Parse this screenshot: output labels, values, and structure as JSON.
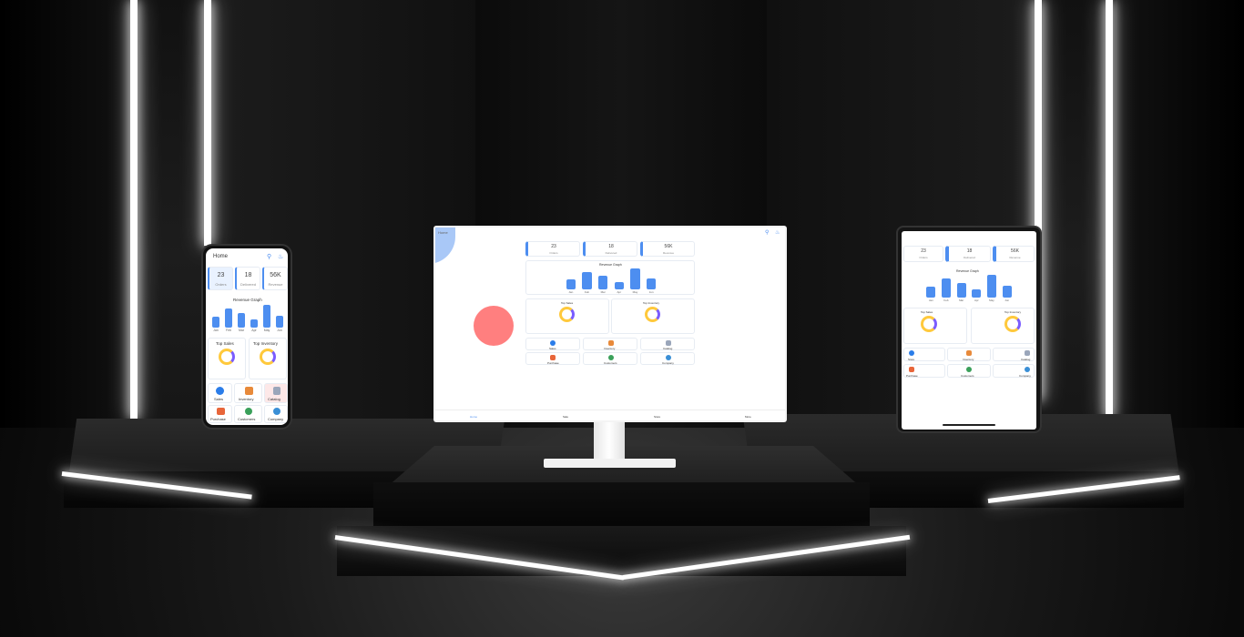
{
  "colors": {
    "accent": "#4d8ef0",
    "donut_a": "#ffc93c",
    "donut_b": "#7a5cff",
    "coral": "#ff7f7f"
  },
  "phone": {
    "title": "Home",
    "stats": [
      {
        "value": "23",
        "label": "Orders"
      },
      {
        "value": "18",
        "label": "Delivered"
      },
      {
        "value": "56K",
        "label": "Revenue"
      }
    ],
    "chart_title": "Revenue Graph",
    "months": [
      "Jan",
      "Feb",
      "Mar",
      "Apr",
      "May",
      "Jun"
    ],
    "top_sales": "Top Sales",
    "top_inventory": "Top Inventory",
    "menu": [
      "Sales",
      "Inventory",
      "Catalog",
      "Purchase",
      "Customers",
      "Company"
    ]
  },
  "monitor": {
    "title": "Home",
    "stats": [
      {
        "value": "23",
        "label": "Orders"
      },
      {
        "value": "18",
        "label": "Delivered"
      },
      {
        "value": "56K",
        "label": "Revenue"
      }
    ],
    "chart_title": "Revenue Graph",
    "months": [
      "Jan",
      "Feb",
      "Mar",
      "Apr",
      "May",
      "Jun"
    ],
    "top_sales": "Top Sales",
    "top_inventory": "Top Inventory",
    "menu": [
      "Sales",
      "Inventory",
      "Catalog",
      "Purchase",
      "Customers",
      "Company"
    ],
    "bottom_nav": [
      "Home",
      "Sale",
      "Store",
      "More"
    ]
  },
  "tablet": {
    "stats": [
      {
        "value": "23",
        "label": "Orders"
      },
      {
        "value": "18",
        "label": "Delivered"
      },
      {
        "value": "56K",
        "label": "Revenue"
      }
    ],
    "chart_title": "Revenue Graph",
    "months": [
      "Jan",
      "Feb",
      "Mar",
      "Apr",
      "May",
      "Jun"
    ],
    "top_sales": "Top Sales",
    "top_inventory": "Top Inventory",
    "menu": [
      "Store",
      "Inventory",
      "Catalog",
      "Purchase",
      "Customers",
      "Company"
    ]
  },
  "chart_data": {
    "type": "bar",
    "categories": [
      "Jan",
      "Feb",
      "Mar",
      "Apr",
      "May",
      "Jun"
    ],
    "values": [
      45,
      80,
      60,
      35,
      95,
      50
    ]
  }
}
